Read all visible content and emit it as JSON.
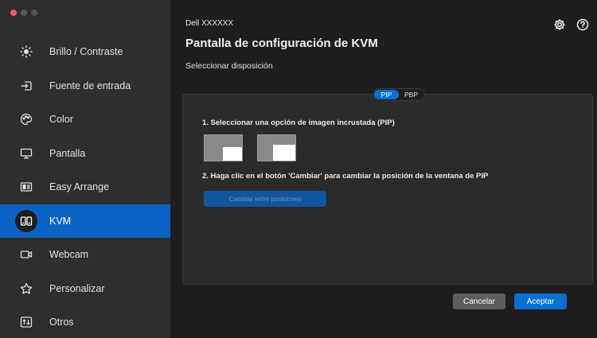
{
  "window": {
    "traffic_lights": [
      "close",
      "minimize",
      "maximize"
    ],
    "colors": {
      "close": "#ff5f57",
      "inactive": "#555555"
    }
  },
  "sidebar": {
    "items": [
      {
        "label": "Brillo / Contraste",
        "icon": "brightness-icon",
        "active": false
      },
      {
        "label": "Fuente de entrada",
        "icon": "input-source-icon",
        "active": false
      },
      {
        "label": "Color",
        "icon": "color-palette-icon",
        "active": false
      },
      {
        "label": "Pantalla",
        "icon": "display-icon",
        "active": false
      },
      {
        "label": "Easy Arrange",
        "icon": "easy-arrange-icon",
        "active": false
      },
      {
        "label": "KVM",
        "icon": "kvm-icon",
        "active": true
      },
      {
        "label": "Webcam",
        "icon": "webcam-icon",
        "active": false
      },
      {
        "label": "Personalizar",
        "icon": "star-icon",
        "active": false
      },
      {
        "label": "Otros",
        "icon": "others-icon",
        "active": false
      }
    ],
    "active_color": "#0d63c4"
  },
  "header": {
    "monitor_name": "Dell XXXXXX",
    "title": "Pantalla de configuración de KVM",
    "subtitle": "Seleccionar disposición",
    "icons": [
      "settings-gear-icon",
      "help-icon"
    ]
  },
  "layout_toggle": {
    "options": [
      "PIP",
      "PBP"
    ],
    "selected": "PIP"
  },
  "panel": {
    "step1": "1. Seleccionar una opción de imagen incrustada (PIP)",
    "pip_options": [
      "pip-bottom-right",
      "pip-bottom-right-large"
    ],
    "step2": "2. Haga clic en el botón 'Cambiar' para cambiar la posición de la ventana de PIP",
    "swap_label": "Cambiar entre posiciones"
  },
  "footer": {
    "cancel_label": "Cancelar",
    "accept_label": "Aceptar",
    "accent": "#0a6fd1"
  }
}
